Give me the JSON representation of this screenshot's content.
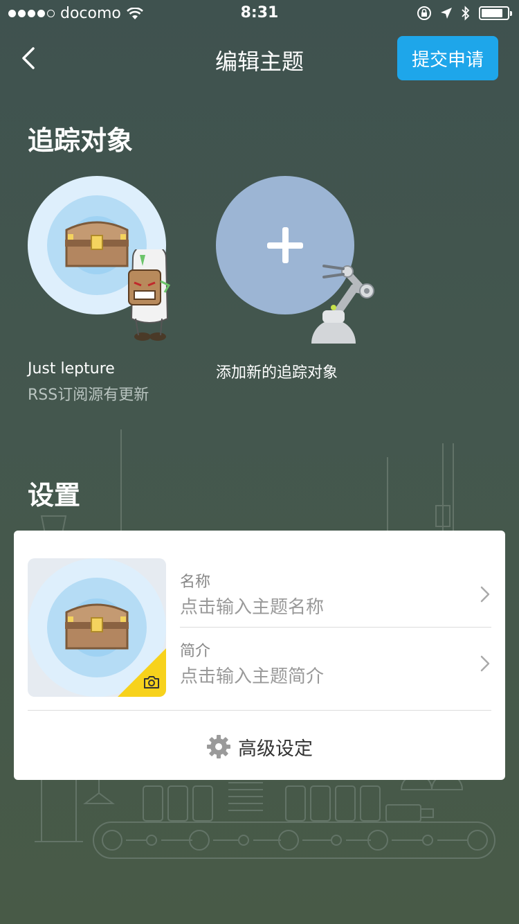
{
  "status_bar": {
    "carrier": "docomo",
    "time": "8:31",
    "signal_bars": 4,
    "battery_level": 0.85
  },
  "nav": {
    "title": "编辑主题",
    "submit_label": "提交申请",
    "back_icon": "chevron-left-icon"
  },
  "tracking": {
    "title": "追踪对象",
    "items": [
      {
        "name": "Just lepture",
        "subtitle": "RSS订阅源有更新"
      }
    ],
    "add_label": "添加新的追踪对象"
  },
  "settings": {
    "title": "设置",
    "name_label": "名称",
    "name_placeholder": "点击输入主题名称",
    "intro_label": "简介",
    "intro_placeholder": "点击输入主题简介",
    "advanced_label": "高级设定"
  },
  "colors": {
    "accent": "#1ea6ea",
    "background": "#44574e",
    "thumb_badge": "#f7d21c",
    "add_circle": "#9cb5d4"
  }
}
